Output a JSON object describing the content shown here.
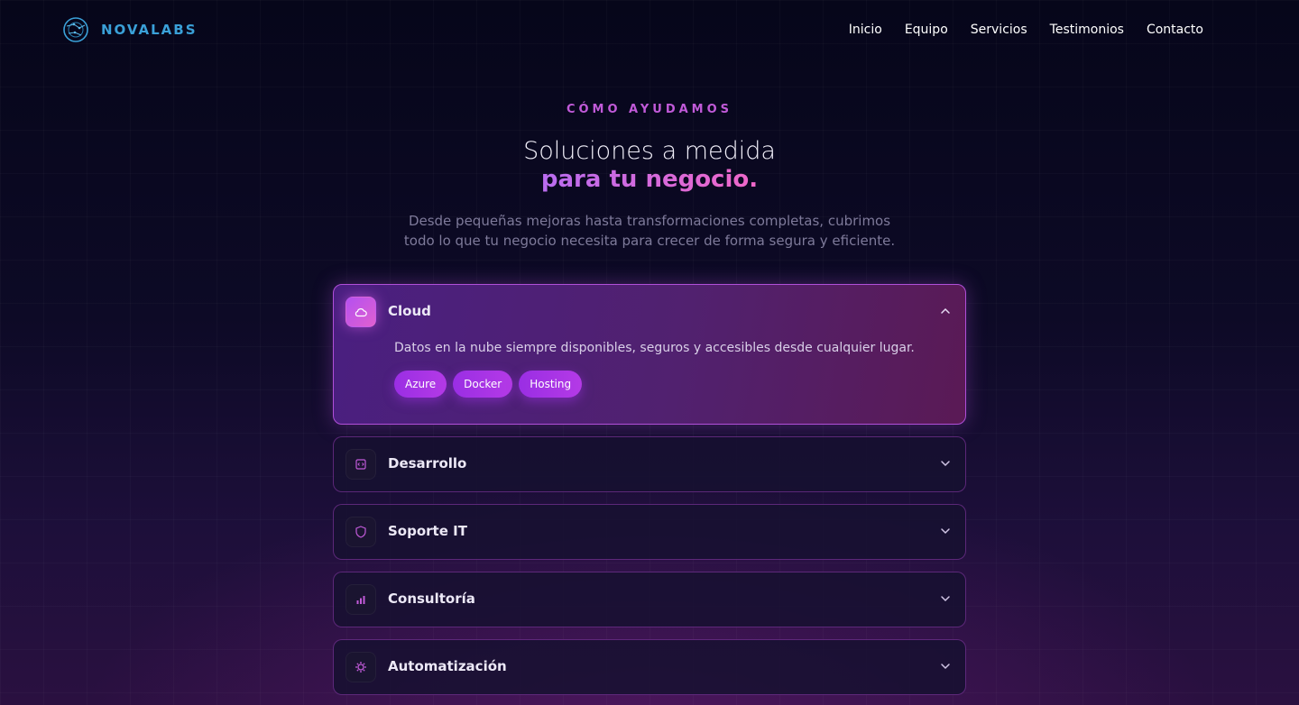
{
  "header": {
    "brand": "NOVALABS",
    "nav": [
      "Inicio",
      "Equipo",
      "Servicios",
      "Testimonios",
      "Contacto"
    ]
  },
  "hero": {
    "eyebrow": "CÓMO AYUDAMOS",
    "title_line1": "Soluciones a medida",
    "title_line2": "para tu negocio.",
    "description_line1": "Desde pequeñas mejoras hasta transformaciones completas, cubrimos",
    "description_line2": "todo lo que tu negocio necesita para crecer de forma segura y eficiente."
  },
  "services": [
    {
      "title": "Cloud",
      "icon": "cloud-icon",
      "expanded": true,
      "description": "Datos en la nube siempre disponibles, seguros y accesibles desde cualquier lugar.",
      "tags": [
        "Azure",
        "Docker",
        "Hosting"
      ]
    },
    {
      "title": "Desarrollo",
      "icon": "code-icon",
      "expanded": false
    },
    {
      "title": "Soporte IT",
      "icon": "shield-icon",
      "expanded": false
    },
    {
      "title": "Consultoría",
      "icon": "bar-chart-icon",
      "expanded": false
    },
    {
      "title": "Automatización",
      "icon": "gear-icon",
      "expanded": false
    }
  ],
  "colors": {
    "accent_pink": "#c15ad9",
    "brand_blue": "#3aa0d8",
    "tag_purple": "#a534e5"
  }
}
